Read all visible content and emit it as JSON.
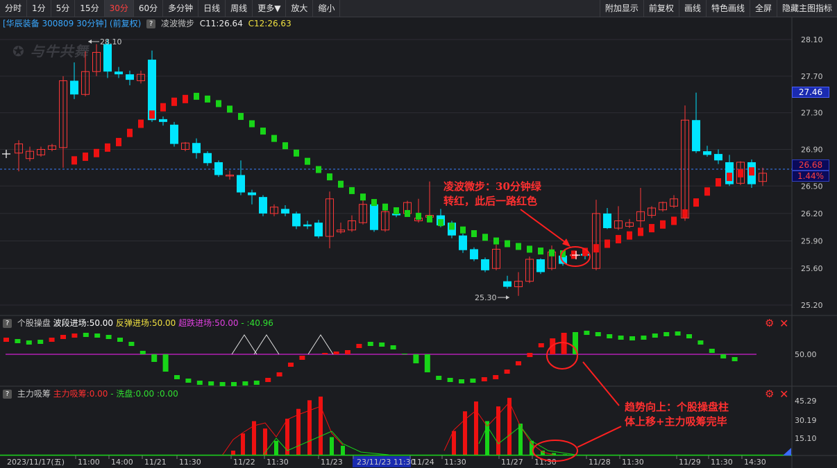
{
  "toolbar": {
    "left": [
      "分时",
      "1分",
      "5分",
      "15分",
      "30分",
      "60分",
      "多分钟",
      "日线",
      "周线",
      "更多▼",
      "放大",
      "缩小"
    ],
    "active": "30分",
    "right": [
      "附加显示",
      "前复权",
      "画线",
      "特色画线",
      "全屏",
      "隐藏主图指标"
    ]
  },
  "main_info": {
    "stock": "[华辰装备 300809 30分钟]",
    "adjust": "(前复权)",
    "help": "?",
    "indicator": "凌波微步",
    "c1": "C11:26.64",
    "c2": "C12:26.63"
  },
  "logo_text": "与牛共舞",
  "price_axis": [
    "28.10",
    "27.70",
    "27.30",
    "26.90",
    "26.50",
    "26.20",
    "25.90",
    "25.60",
    "25.20"
  ],
  "price_tags": {
    "tag1": "27.46",
    "tag2": "26.68",
    "tag3": "1.44%"
  },
  "high_label": "28.10",
  "low_label": "25.30",
  "ind1": {
    "help": "?",
    "name": "个股操盘",
    "p1": "波段进场:50.00",
    "p2": "反弹进场:50.00",
    "p3": "超跌进场:50.00",
    "p4": "- :40.96",
    "axis": "50.00"
  },
  "ind2": {
    "help": "?",
    "name": "主力吸筹",
    "p1": "主力吸筹:0.00",
    "p2": "- 洗盘:0.00",
    "p3": ":0.00",
    "axis": [
      "45.29",
      "30.19",
      "15.10"
    ]
  },
  "time_axis": [
    "2023/11/17(五)",
    "11:00",
    "14:00",
    "11/21",
    "11:30",
    "11/22",
    "11:30",
    "11/23",
    "23/11/23 11:30",
    "11/24",
    "11:30",
    "11/27",
    "11:30",
    "11/28",
    "11:30",
    "11/29",
    "11:30",
    "14:30"
  ],
  "annotations": {
    "a1_line1": "凌波微步：30分钟绿",
    "a1_line2": "转红，此后一路红色",
    "a2_line1": "趋势向上：个股操盘柱",
    "a2_line2": "体上移+主力吸筹完毕"
  },
  "colors": {
    "up": "#ff3030",
    "down": "#00e5ff",
    "green": "#1ed41e",
    "red": "#ee1111",
    "magenta": "#d020d0"
  }
}
